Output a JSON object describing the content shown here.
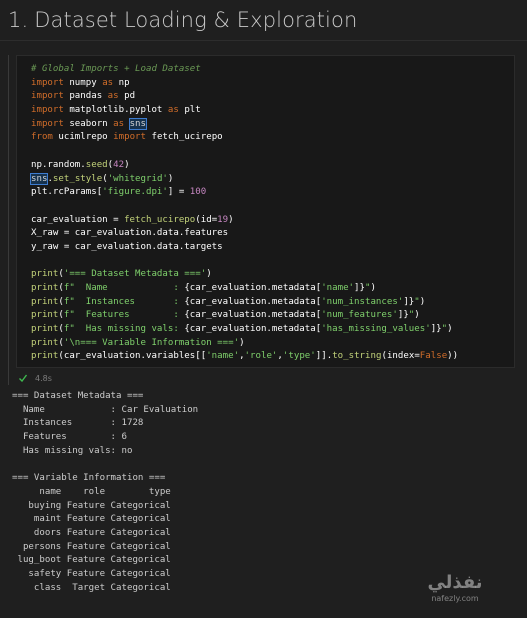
{
  "heading": {
    "number": "1.",
    "title": "Dataset Loading & Exploration"
  },
  "cell": {
    "status_icon": "check-icon",
    "exec_time": "4.8s",
    "code_lines": [
      [
        [
          "cm",
          "# Global Imports + Load Dataset"
        ]
      ],
      [
        [
          "kw",
          "import"
        ],
        [
          "id",
          " numpy "
        ],
        [
          "kw",
          "as"
        ],
        [
          "id",
          " np"
        ]
      ],
      [
        [
          "kw",
          "import"
        ],
        [
          "id",
          " pandas "
        ],
        [
          "kw",
          "as"
        ],
        [
          "id",
          " pd"
        ]
      ],
      [
        [
          "kw",
          "import"
        ],
        [
          "id",
          " matplotlib.pyplot "
        ],
        [
          "kw",
          "as"
        ],
        [
          "id",
          " plt"
        ]
      ],
      [
        [
          "kw",
          "import"
        ],
        [
          "id",
          " seaborn "
        ],
        [
          "kw",
          "as"
        ],
        [
          "id",
          " "
        ],
        [
          "sel",
          "sns"
        ]
      ],
      [
        [
          "kw",
          "from"
        ],
        [
          "id",
          " ucimlrepo "
        ],
        [
          "kw",
          "import"
        ],
        [
          "id",
          " fetch_ucirepo"
        ]
      ],
      [
        [
          "id",
          ""
        ]
      ],
      [
        [
          "id",
          "np.random."
        ],
        [
          "fn",
          "seed"
        ],
        [
          "id",
          "("
        ],
        [
          "num",
          "42"
        ],
        [
          "id",
          ")"
        ]
      ],
      [
        [
          "sel",
          "sns"
        ],
        [
          "id",
          "."
        ],
        [
          "fn",
          "set_style"
        ],
        [
          "id",
          "("
        ],
        [
          "str",
          "'whitegrid'"
        ],
        [
          "id",
          ")"
        ]
      ],
      [
        [
          "id",
          "plt.rcParams["
        ],
        [
          "str",
          "'figure.dpi'"
        ],
        [
          "id",
          "] = "
        ],
        [
          "num",
          "100"
        ]
      ],
      [
        [
          "id",
          ""
        ]
      ],
      [
        [
          "id",
          "car_evaluation = "
        ],
        [
          "fn",
          "fetch_ucirepo"
        ],
        [
          "id",
          "(id="
        ],
        [
          "num",
          "19"
        ],
        [
          "id",
          ")"
        ]
      ],
      [
        [
          "id",
          "X_raw = car_evaluation.data.features"
        ]
      ],
      [
        [
          "id",
          "y_raw = car_evaluation.data.targets"
        ]
      ],
      [
        [
          "id",
          ""
        ]
      ],
      [
        [
          "fn",
          "print"
        ],
        [
          "id",
          "("
        ],
        [
          "str",
          "'=== Dataset Metadata ==='"
        ],
        [
          "id",
          ")"
        ]
      ],
      [
        [
          "fn",
          "print"
        ],
        [
          "id",
          "("
        ],
        [
          "str",
          "f\"  Name            : "
        ],
        [
          "id",
          "{car_evaluation.metadata["
        ],
        [
          "str",
          "'name'"
        ],
        [
          "id",
          "]}"
        ],
        [
          "str",
          "\""
        ],
        [
          "id",
          ")"
        ]
      ],
      [
        [
          "fn",
          "print"
        ],
        [
          "id",
          "("
        ],
        [
          "str",
          "f\"  Instances       : "
        ],
        [
          "id",
          "{car_evaluation.metadata["
        ],
        [
          "str",
          "'num_instances'"
        ],
        [
          "id",
          "]}"
        ],
        [
          "str",
          "\""
        ],
        [
          "id",
          ")"
        ]
      ],
      [
        [
          "fn",
          "print"
        ],
        [
          "id",
          "("
        ],
        [
          "str",
          "f\"  Features        : "
        ],
        [
          "id",
          "{car_evaluation.metadata["
        ],
        [
          "str",
          "'num_features'"
        ],
        [
          "id",
          "]}"
        ],
        [
          "str",
          "\""
        ],
        [
          "id",
          ")"
        ]
      ],
      [
        [
          "fn",
          "print"
        ],
        [
          "id",
          "("
        ],
        [
          "str",
          "f\"  Has missing vals: "
        ],
        [
          "id",
          "{car_evaluation.metadata["
        ],
        [
          "str",
          "'has_missing_values'"
        ],
        [
          "id",
          "]}"
        ],
        [
          "str",
          "\""
        ],
        [
          "id",
          ")"
        ]
      ],
      [
        [
          "fn",
          "print"
        ],
        [
          "id",
          "("
        ],
        [
          "str",
          "'\\n=== Variable Information ==='"
        ],
        [
          "id",
          ")"
        ]
      ],
      [
        [
          "fn",
          "print"
        ],
        [
          "id",
          "(car_evaluation.variables[["
        ],
        [
          "str",
          "'name'"
        ],
        [
          "id",
          ","
        ],
        [
          "str",
          "'role'"
        ],
        [
          "id",
          ","
        ],
        [
          "str",
          "'type'"
        ],
        [
          "id",
          "]]."
        ],
        [
          "fn",
          "to_string"
        ],
        [
          "id",
          "(index="
        ],
        [
          "kw",
          "False"
        ],
        [
          "id",
          "))"
        ]
      ]
    ]
  },
  "output": {
    "lines": [
      "=== Dataset Metadata ===",
      "  Name            : Car Evaluation",
      "  Instances       : 1728",
      "  Features        : 6",
      "  Has missing vals: no",
      "",
      "=== Variable Information ===",
      "     name    role        type",
      "   buying Feature Categorical",
      "    maint Feature Categorical",
      "    doors Feature Categorical",
      "  persons Feature Categorical",
      " lug_boot Feature Categorical",
      "   safety Feature Categorical",
      "    class  Target Categorical"
    ]
  },
  "watermark": {
    "arabic": "نفذلي",
    "latin": "nafezly.com"
  },
  "colors": {
    "background": "#1f1f1f",
    "code_background": "#181818",
    "keyword": "#d16d2a",
    "function": "#c2d27a",
    "string": "#7fd06c",
    "number": "#c586c0",
    "comment": "#6a9955",
    "success": "#3fb950"
  }
}
